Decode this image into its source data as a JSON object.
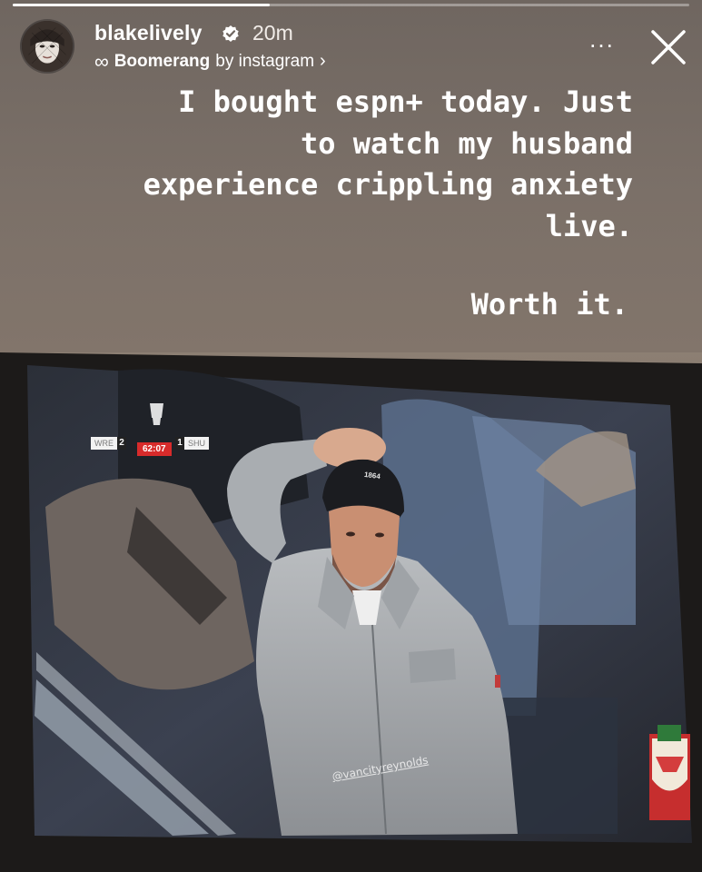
{
  "story": {
    "progress": 0.38,
    "username": "blakelively",
    "time_ago": "20m",
    "audio_prefix": "∞",
    "audio_label": "Boomerang",
    "audio_suffix": "by instagram",
    "audio_chevron": "›",
    "more_label": "...",
    "icons": {
      "verified": "verified-badge-icon",
      "more": "more-dots-icon",
      "close": "close-icon"
    }
  },
  "caption": {
    "text": "I bought  espn+ today. Just\nto watch my husband\nexperience crippling anxiety\nlive.",
    "text_2": "Worth it."
  },
  "tv": {
    "scoreboard": {
      "home_team": "WRE",
      "home_score": "2",
      "clock": "62:07",
      "away_score": "1",
      "away_team": "SHU"
    },
    "beanie_text": "1864",
    "watermark": "@vancityreynolds"
  },
  "colors": {
    "background": "#7a6f66",
    "text": "#ffffff",
    "verified_blue": "#3897f0",
    "clock_red": "#d82b2b"
  }
}
